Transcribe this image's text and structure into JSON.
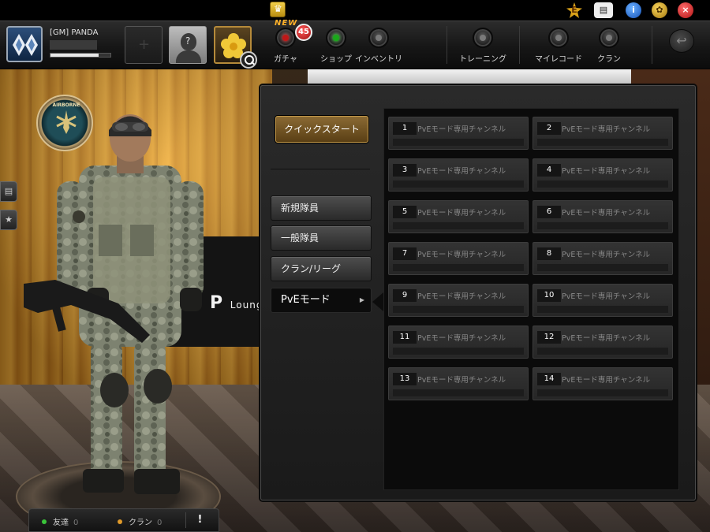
{
  "player": {
    "name": "[GM] PANDA",
    "exp_progress": 0.8
  },
  "topbar": {
    "new_label": "NEW",
    "gacha_count": "45",
    "menu": [
      {
        "label": "ガチャ",
        "state": "red"
      },
      {
        "label": "ショップ",
        "state": "green"
      },
      {
        "label": "インベントリ",
        "state": "off"
      },
      {
        "label": "トレーニング",
        "state": "off"
      },
      {
        "label": "マイレコード",
        "state": "off"
      },
      {
        "label": "クラン",
        "state": "off"
      }
    ],
    "system_icons": [
      "trophy-icon",
      "event-icon",
      "card-icon",
      "info-icon",
      "settings-icon",
      "close-icon"
    ],
    "system_glyphs": {
      "event": "E",
      "info": "i",
      "close": "×"
    }
  },
  "scene": {
    "sign": "P",
    "sign_small": "Loung",
    "badge_text": "AIRBORNE"
  },
  "panel": {
    "quickstart_label": "クイックスタート",
    "modes": [
      {
        "label": "新規隊員",
        "active": false
      },
      {
        "label": "一般隊員",
        "active": false
      },
      {
        "label": "クラン/リーグ",
        "active": false
      },
      {
        "label": "PvEモード",
        "active": true
      }
    ],
    "channels": [
      {
        "num": "1",
        "name": "PvEモード専用チャンネル"
      },
      {
        "num": "2",
        "name": "PvEモード専用チャンネル"
      },
      {
        "num": "3",
        "name": "PvEモード専用チャンネル"
      },
      {
        "num": "4",
        "name": "PvEモード専用チャンネル"
      },
      {
        "num": "5",
        "name": "PvEモード専用チャンネル"
      },
      {
        "num": "6",
        "name": "PvEモード専用チャンネル"
      },
      {
        "num": "7",
        "name": "PvEモード専用チャンネル"
      },
      {
        "num": "8",
        "name": "PvEモード専用チャンネル"
      },
      {
        "num": "9",
        "name": "PvEモード専用チャンネル"
      },
      {
        "num": "10",
        "name": "PvEモード専用チャンネル"
      },
      {
        "num": "11",
        "name": "PvEモード専用チャンネル"
      },
      {
        "num": "12",
        "name": "PvEモード専用チャンネル"
      },
      {
        "num": "13",
        "name": "PvEモード専用チャンネル"
      },
      {
        "num": "14",
        "name": "PvEモード専用チャンネル"
      }
    ]
  },
  "bottom": {
    "friends_label": "友達",
    "friends_count": "0",
    "clan_label": "クラン",
    "clan_count": "0",
    "alert_label": "!"
  }
}
